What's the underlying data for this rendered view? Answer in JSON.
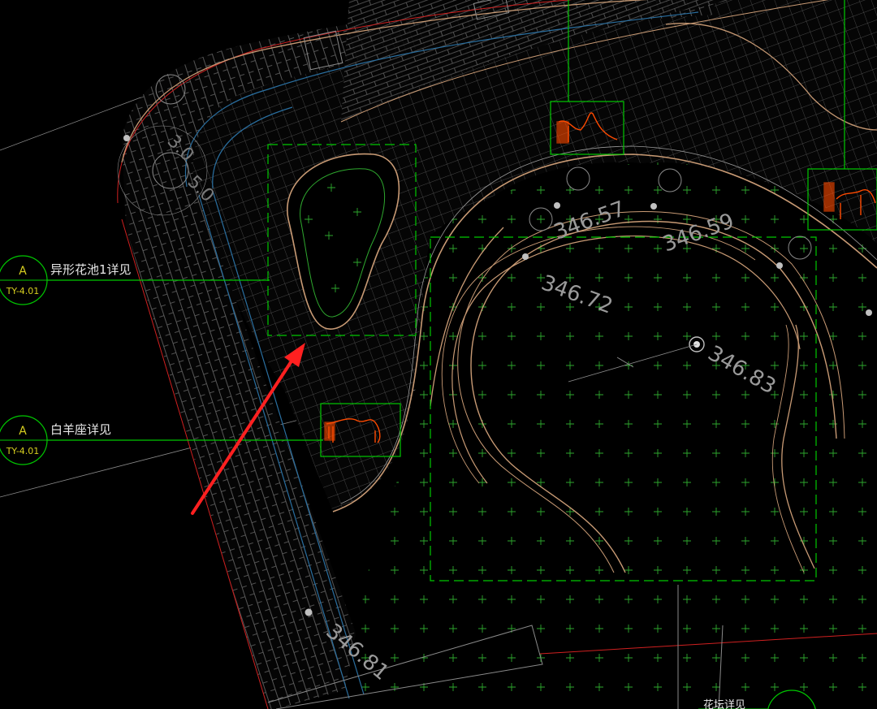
{
  "callouts": [
    {
      "letter": "A",
      "sheet": "TY-4.01",
      "label": "异形花池1详见"
    },
    {
      "letter": "A",
      "sheet": "TY-4.01",
      "label": "白羊座详见"
    },
    {
      "label": "花坛详见"
    }
  ],
  "elevations": [
    "346.57",
    "346.59",
    "346.72",
    "346.83",
    "346.81"
  ],
  "faint_dims": [
    "3.0",
    "5.0"
  ],
  "colors": {
    "background": "#000000",
    "leader_green": "#00c800",
    "hatch": "#707070",
    "curb_brown": "#c89a74",
    "boundary_red": "#d02020",
    "blue_line": "#2a6fa0",
    "sculpture_orange": "#ff4a00",
    "callout_yellow": "#d8d020",
    "arrow_red": "#ff2020"
  }
}
